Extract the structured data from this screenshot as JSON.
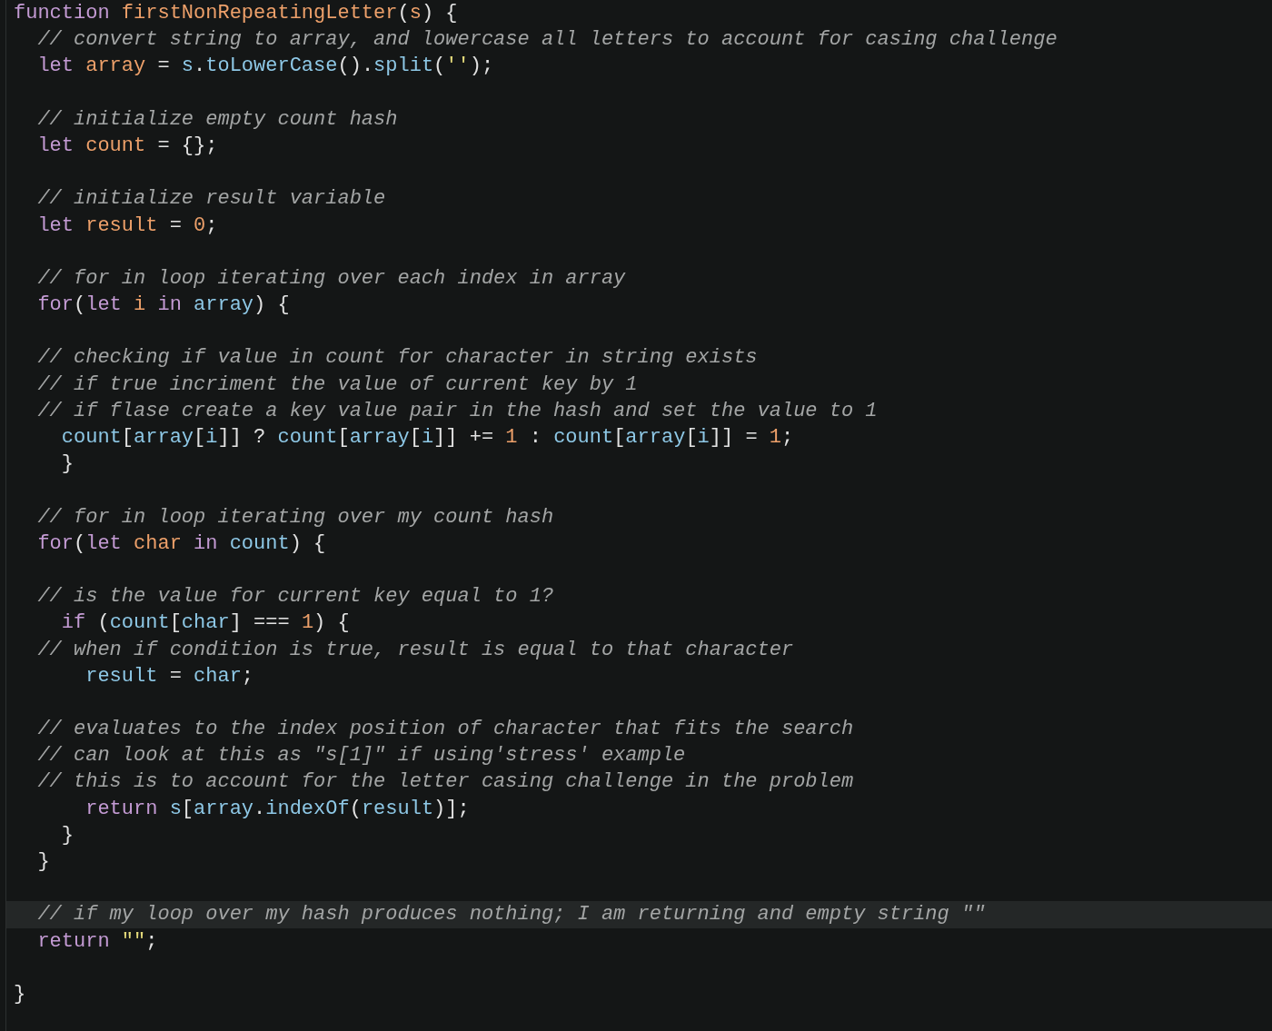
{
  "editor": {
    "lines": [
      {
        "kind": "code",
        "current": false,
        "tokens": [
          {
            "text": "function ",
            "kind": "keyword"
          },
          {
            "text": "firstNonRepeatingLetter",
            "kind": "function"
          },
          {
            "text": "(",
            "kind": "punct"
          },
          {
            "text": "s",
            "kind": "variable"
          },
          {
            "text": ") {",
            "kind": "punct"
          }
        ]
      },
      {
        "kind": "code",
        "current": false,
        "tokens": [
          {
            "text": "  // convert string to array, and lowercase all letters to account for casing challenge",
            "kind": "comment"
          }
        ]
      },
      {
        "kind": "code",
        "current": false,
        "tokens": [
          {
            "text": "  let ",
            "kind": "keyword"
          },
          {
            "text": "array",
            "kind": "variable"
          },
          {
            "text": " = ",
            "kind": "punct"
          },
          {
            "text": "s",
            "kind": "identifier"
          },
          {
            "text": ".",
            "kind": "punct"
          },
          {
            "text": "toLowerCase",
            "kind": "identifier"
          },
          {
            "text": "().",
            "kind": "punct"
          },
          {
            "text": "split",
            "kind": "identifier"
          },
          {
            "text": "(",
            "kind": "punct"
          },
          {
            "text": "''",
            "kind": "string"
          },
          {
            "text": ");",
            "kind": "punct"
          }
        ]
      },
      {
        "kind": "blank",
        "current": false
      },
      {
        "kind": "code",
        "current": false,
        "tokens": [
          {
            "text": "  // initialize empty count hash",
            "kind": "comment"
          }
        ]
      },
      {
        "kind": "code",
        "current": false,
        "tokens": [
          {
            "text": "  let ",
            "kind": "keyword"
          },
          {
            "text": "count",
            "kind": "variable"
          },
          {
            "text": " = {};",
            "kind": "punct"
          }
        ]
      },
      {
        "kind": "blank",
        "current": false
      },
      {
        "kind": "code",
        "current": false,
        "tokens": [
          {
            "text": "  // initialize result variable",
            "kind": "comment"
          }
        ]
      },
      {
        "kind": "code",
        "current": false,
        "tokens": [
          {
            "text": "  let ",
            "kind": "keyword"
          },
          {
            "text": "result",
            "kind": "variable"
          },
          {
            "text": " = ",
            "kind": "punct"
          },
          {
            "text": "0",
            "kind": "number"
          },
          {
            "text": ";",
            "kind": "punct"
          }
        ]
      },
      {
        "kind": "blank",
        "current": false
      },
      {
        "kind": "code",
        "current": false,
        "tokens": [
          {
            "text": "  // for in loop iterating over each index in array",
            "kind": "comment"
          }
        ]
      },
      {
        "kind": "code",
        "current": false,
        "tokens": [
          {
            "text": "  for",
            "kind": "keyword"
          },
          {
            "text": "(",
            "kind": "punct"
          },
          {
            "text": "let ",
            "kind": "keyword"
          },
          {
            "text": "i",
            "kind": "variable"
          },
          {
            "text": " in ",
            "kind": "keyword"
          },
          {
            "text": "array",
            "kind": "identifier"
          },
          {
            "text": ") {",
            "kind": "punct"
          }
        ]
      },
      {
        "kind": "blank",
        "current": false
      },
      {
        "kind": "code",
        "current": false,
        "tokens": [
          {
            "text": "  // checking if value in count for character in string exists",
            "kind": "comment"
          }
        ]
      },
      {
        "kind": "code",
        "current": false,
        "tokens": [
          {
            "text": "  // if true incriment the value of current key by 1",
            "kind": "comment"
          }
        ]
      },
      {
        "kind": "code",
        "current": false,
        "tokens": [
          {
            "text": "  // if flase create a key value pair in the hash and set the value to 1",
            "kind": "comment"
          }
        ]
      },
      {
        "kind": "code",
        "current": false,
        "tokens": [
          {
            "text": "    count",
            "kind": "identifier"
          },
          {
            "text": "[",
            "kind": "punct"
          },
          {
            "text": "array",
            "kind": "identifier"
          },
          {
            "text": "[",
            "kind": "punct"
          },
          {
            "text": "i",
            "kind": "identifier"
          },
          {
            "text": "]] ? ",
            "kind": "punct"
          },
          {
            "text": "count",
            "kind": "identifier"
          },
          {
            "text": "[",
            "kind": "punct"
          },
          {
            "text": "array",
            "kind": "identifier"
          },
          {
            "text": "[",
            "kind": "punct"
          },
          {
            "text": "i",
            "kind": "identifier"
          },
          {
            "text": "]] += ",
            "kind": "punct"
          },
          {
            "text": "1",
            "kind": "number"
          },
          {
            "text": " : ",
            "kind": "punct"
          },
          {
            "text": "count",
            "kind": "identifier"
          },
          {
            "text": "[",
            "kind": "punct"
          },
          {
            "text": "array",
            "kind": "identifier"
          },
          {
            "text": "[",
            "kind": "punct"
          },
          {
            "text": "i",
            "kind": "identifier"
          },
          {
            "text": "]] = ",
            "kind": "punct"
          },
          {
            "text": "1",
            "kind": "number"
          },
          {
            "text": ";",
            "kind": "punct"
          }
        ]
      },
      {
        "kind": "code",
        "current": false,
        "tokens": [
          {
            "text": "    }",
            "kind": "punct"
          }
        ]
      },
      {
        "kind": "blank",
        "current": false
      },
      {
        "kind": "code",
        "current": false,
        "tokens": [
          {
            "text": "  // for in loop iterating over my count hash",
            "kind": "comment"
          }
        ]
      },
      {
        "kind": "code",
        "current": false,
        "tokens": [
          {
            "text": "  for",
            "kind": "keyword"
          },
          {
            "text": "(",
            "kind": "punct"
          },
          {
            "text": "let ",
            "kind": "keyword"
          },
          {
            "text": "char",
            "kind": "variable"
          },
          {
            "text": " in ",
            "kind": "keyword"
          },
          {
            "text": "count",
            "kind": "identifier"
          },
          {
            "text": ") {",
            "kind": "punct"
          }
        ]
      },
      {
        "kind": "blank",
        "current": false
      },
      {
        "kind": "code",
        "current": false,
        "tokens": [
          {
            "text": "  // is the value for current key equal to 1?",
            "kind": "comment"
          }
        ]
      },
      {
        "kind": "code",
        "current": false,
        "tokens": [
          {
            "text": "    if",
            "kind": "keyword"
          },
          {
            "text": " (",
            "kind": "punct"
          },
          {
            "text": "count",
            "kind": "identifier"
          },
          {
            "text": "[",
            "kind": "punct"
          },
          {
            "text": "char",
            "kind": "identifier"
          },
          {
            "text": "] === ",
            "kind": "punct"
          },
          {
            "text": "1",
            "kind": "number"
          },
          {
            "text": ") {",
            "kind": "punct"
          }
        ]
      },
      {
        "kind": "code",
        "current": false,
        "tokens": [
          {
            "text": "  // when if condition is true, result is equal to that character",
            "kind": "comment"
          }
        ]
      },
      {
        "kind": "code",
        "current": false,
        "tokens": [
          {
            "text": "      result",
            "kind": "identifier"
          },
          {
            "text": " = ",
            "kind": "punct"
          },
          {
            "text": "char",
            "kind": "identifier"
          },
          {
            "text": ";",
            "kind": "punct"
          }
        ]
      },
      {
        "kind": "blank",
        "current": false
      },
      {
        "kind": "code",
        "current": false,
        "tokens": [
          {
            "text": "  // evaluates to the index position of character that fits the search",
            "kind": "comment"
          }
        ]
      },
      {
        "kind": "code",
        "current": false,
        "tokens": [
          {
            "text": "  // can look at this as \"s[1]\" if using'stress' example",
            "kind": "comment"
          }
        ]
      },
      {
        "kind": "code",
        "current": false,
        "tokens": [
          {
            "text": "  // this is to account for the letter casing challenge in the problem",
            "kind": "comment"
          }
        ]
      },
      {
        "kind": "code",
        "current": false,
        "tokens": [
          {
            "text": "      return ",
            "kind": "keyword"
          },
          {
            "text": "s",
            "kind": "identifier"
          },
          {
            "text": "[",
            "kind": "punct"
          },
          {
            "text": "array",
            "kind": "identifier"
          },
          {
            "text": ".",
            "kind": "punct"
          },
          {
            "text": "indexOf",
            "kind": "identifier"
          },
          {
            "text": "(",
            "kind": "punct"
          },
          {
            "text": "result",
            "kind": "identifier"
          },
          {
            "text": ")];",
            "kind": "punct"
          }
        ]
      },
      {
        "kind": "code",
        "current": false,
        "tokens": [
          {
            "text": "    }",
            "kind": "punct"
          }
        ]
      },
      {
        "kind": "code",
        "current": false,
        "tokens": [
          {
            "text": "  }",
            "kind": "punct"
          }
        ]
      },
      {
        "kind": "blank",
        "current": false
      },
      {
        "kind": "code",
        "current": true,
        "tokens": [
          {
            "text": "  // if my loop over my hash produces nothing; I am returning and empty string \"\"",
            "kind": "comment"
          }
        ]
      },
      {
        "kind": "code",
        "current": false,
        "tokens": [
          {
            "text": "  return ",
            "kind": "keyword"
          },
          {
            "text": "\"\"",
            "kind": "string"
          },
          {
            "text": ";",
            "kind": "punct"
          }
        ]
      },
      {
        "kind": "blank",
        "current": false
      },
      {
        "kind": "code",
        "current": false,
        "tokens": [
          {
            "text": "}",
            "kind": "punct"
          }
        ]
      }
    ]
  }
}
